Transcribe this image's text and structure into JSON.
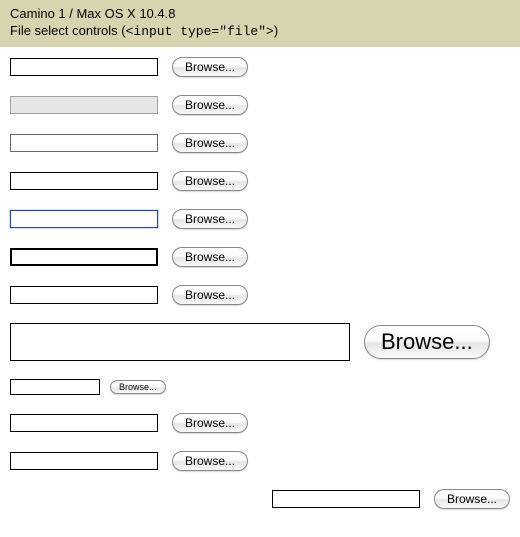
{
  "header": {
    "line1": "Camino 1 / Max OS X 10.4.8",
    "line2_prefix": "File select controls (",
    "line2_code": "<input type=\"file\">",
    "line2_suffix": ")"
  },
  "browse_label": "Browse...",
  "rows": [
    {
      "id": "default",
      "variant": "normal"
    },
    {
      "id": "disabled",
      "variant": "disabled"
    },
    {
      "id": "styled1",
      "variant": "styled-border"
    },
    {
      "id": "styled2",
      "variant": "normal"
    },
    {
      "id": "focus",
      "variant": "bluefocus"
    },
    {
      "id": "thick",
      "variant": "thick"
    },
    {
      "id": "plain",
      "variant": "normal"
    },
    {
      "id": "large",
      "variant": "big"
    },
    {
      "id": "small",
      "variant": "small"
    },
    {
      "id": "widthcss",
      "variant": "fixedw"
    },
    {
      "id": "sizeattr",
      "variant": "fixedw"
    },
    {
      "id": "rtl",
      "variant": "rightalign"
    }
  ]
}
